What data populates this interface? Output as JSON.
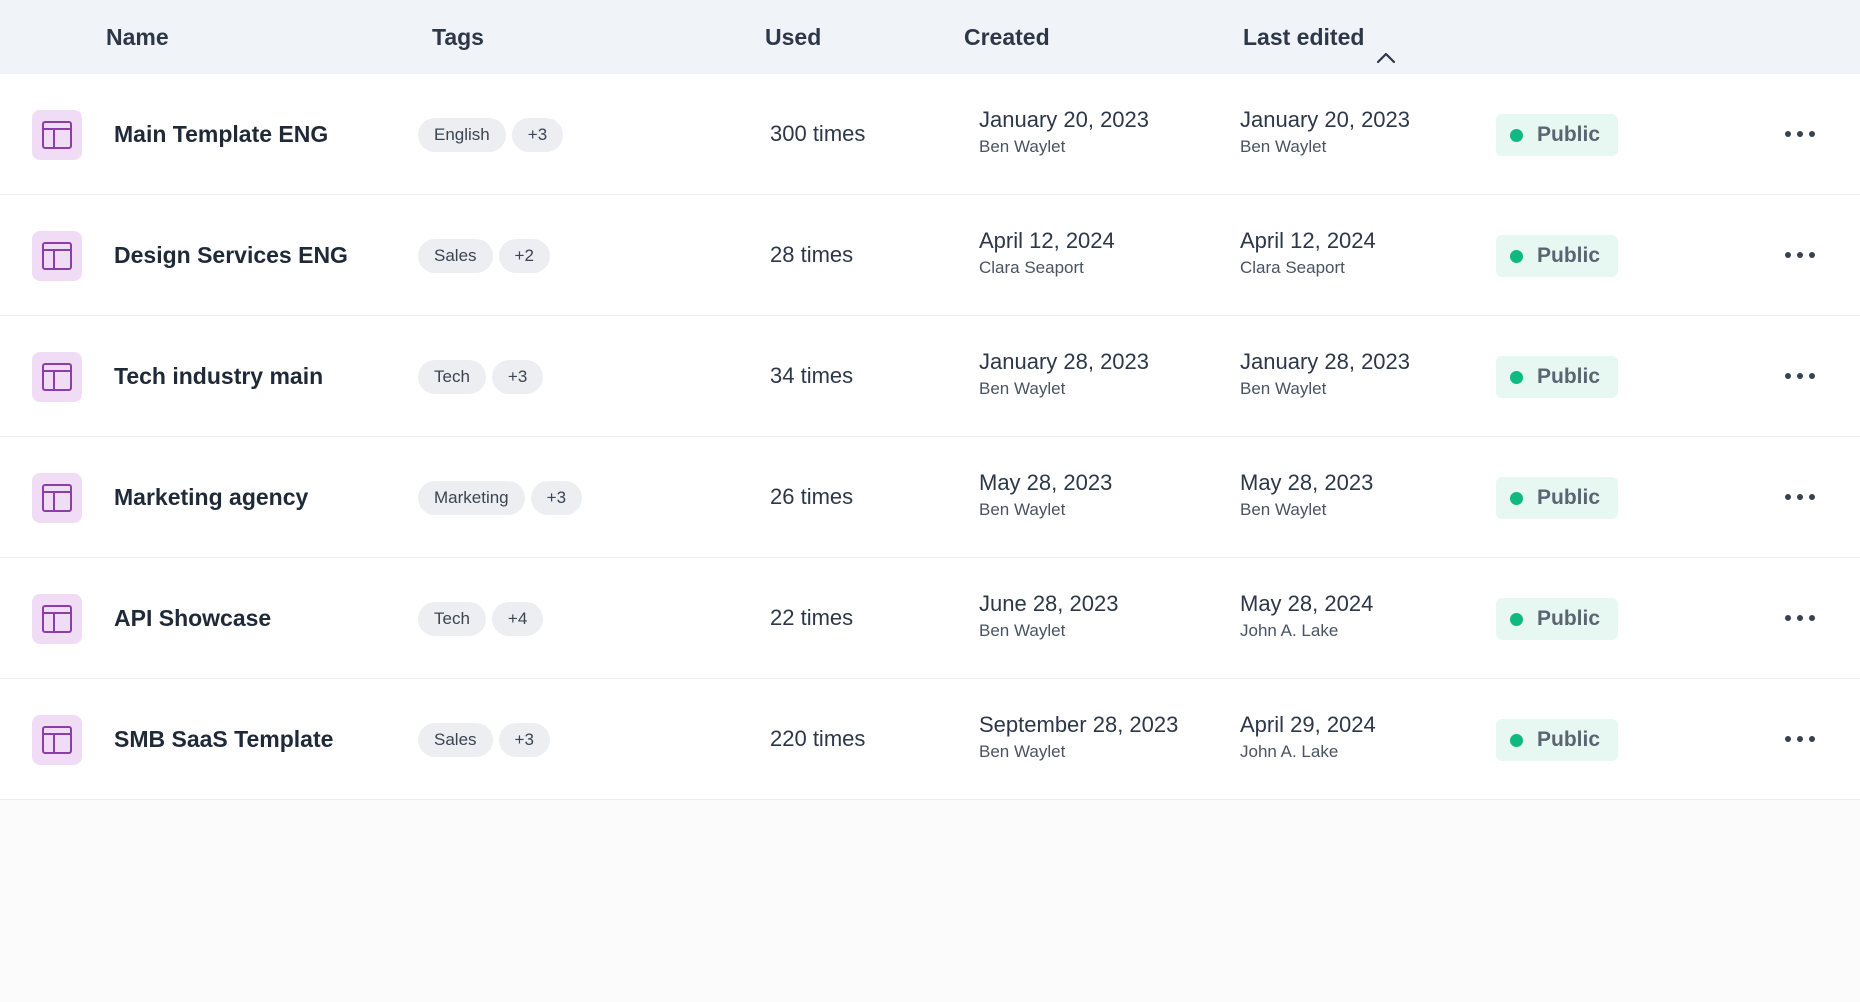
{
  "header": {
    "columns": {
      "name": "Name",
      "tags": "Tags",
      "used": "Used",
      "created": "Created",
      "last_edited": "Last edited"
    },
    "sort_icon": "chevron-up-icon"
  },
  "colors": {
    "accent_purple": "#8b3ea8",
    "icon_bg": "#f1dcf6",
    "public_dot": "#10b981",
    "public_bg": "#e7f8f2"
  },
  "rows": [
    {
      "name": "Main Template ENG",
      "tags": [
        "English",
        "+3"
      ],
      "used": "300 times",
      "created": {
        "date": "January 20, 2023",
        "author": "Ben Waylet"
      },
      "last_edited": {
        "date": "January 20, 2023",
        "author": "Ben Waylet"
      },
      "status": "Public"
    },
    {
      "name": "Design Services ENG",
      "tags": [
        "Sales",
        "+2"
      ],
      "used": "28 times",
      "created": {
        "date": "April 12, 2024",
        "author": "Clara Seaport"
      },
      "last_edited": {
        "date": "April 12, 2024",
        "author": "Clara Seaport"
      },
      "status": "Public"
    },
    {
      "name": "Tech industry main",
      "tags": [
        "Tech",
        "+3"
      ],
      "used": "34 times",
      "created": {
        "date": "January 28, 2023",
        "author": "Ben Waylet"
      },
      "last_edited": {
        "date": "January 28, 2023",
        "author": "Ben Waylet"
      },
      "status": "Public"
    },
    {
      "name": "Marketing agency",
      "tags": [
        "Marketing",
        "+3"
      ],
      "used": "26 times",
      "created": {
        "date": "May 28, 2023",
        "author": "Ben Waylet"
      },
      "last_edited": {
        "date": "May 28, 2023",
        "author": "Ben Waylet"
      },
      "status": "Public"
    },
    {
      "name": "API Showcase",
      "tags": [
        "Tech",
        "+4"
      ],
      "used": "22 times",
      "created": {
        "date": "June 28, 2023",
        "author": "Ben Waylet"
      },
      "last_edited": {
        "date": "May 28, 2024",
        "author": "John A. Lake"
      },
      "status": "Public"
    },
    {
      "name": "SMB SaaS Template",
      "tags": [
        "Sales",
        "+3"
      ],
      "used": "220 times",
      "created": {
        "date": "September 28, 2023",
        "author": "Ben Waylet"
      },
      "last_edited": {
        "date": "April 29, 2024",
        "author": "John A. Lake"
      },
      "status": "Public"
    }
  ]
}
